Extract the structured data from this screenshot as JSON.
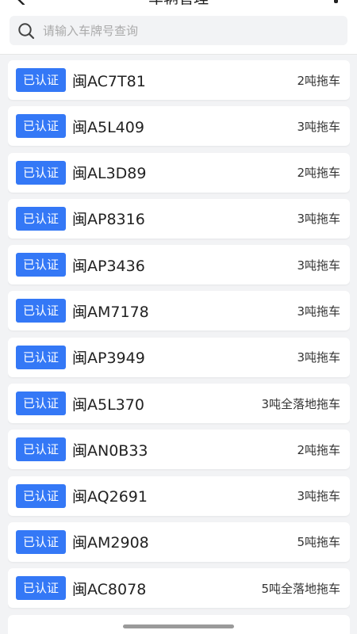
{
  "header": {
    "title": "车辆管理"
  },
  "search": {
    "placeholder": "请输入车牌号查询"
  },
  "vehicles": [
    {
      "badge": "已认证",
      "plate": "闽AC7T81",
      "type": "2吨拖车"
    },
    {
      "badge": "已认证",
      "plate": "闽A5L409",
      "type": "3吨拖车"
    },
    {
      "badge": "已认证",
      "plate": "闽AL3D89",
      "type": "2吨拖车"
    },
    {
      "badge": "已认证",
      "plate": "闽AP8316",
      "type": "3吨拖车"
    },
    {
      "badge": "已认证",
      "plate": "闽AP3436",
      "type": "3吨拖车"
    },
    {
      "badge": "已认证",
      "plate": "闽AM7178",
      "type": "3吨拖车"
    },
    {
      "badge": "已认证",
      "plate": "闽AP3949",
      "type": "3吨拖车"
    },
    {
      "badge": "已认证",
      "plate": "闽A5L370",
      "type": "3吨全落地拖车"
    },
    {
      "badge": "已认证",
      "plate": "闽AN0B33",
      "type": "2吨拖车"
    },
    {
      "badge": "已认证",
      "plate": "闽AQ2691",
      "type": "3吨拖车"
    },
    {
      "badge": "已认证",
      "plate": "闽AM2908",
      "type": "5吨拖车"
    },
    {
      "badge": "已认证",
      "plate": "闽AC8078",
      "type": "5吨全落地拖车"
    },
    {
      "badge": "",
      "plate": "",
      "type": ""
    }
  ],
  "colors": {
    "badge": "#3478f6",
    "background": "#f2f3f5"
  },
  "icons": {
    "back": "chevron-left-icon",
    "more": "more-icon",
    "search": "search-icon"
  }
}
